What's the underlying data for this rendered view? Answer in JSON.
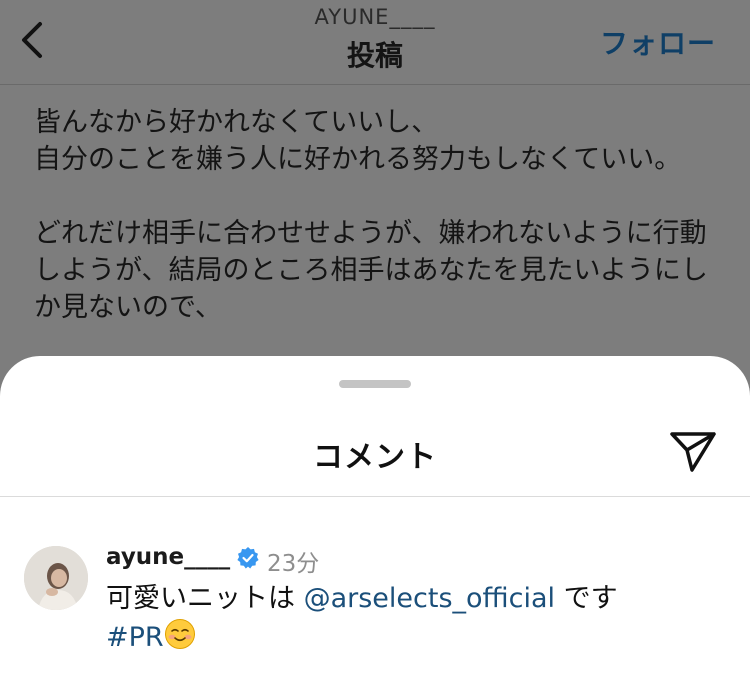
{
  "header": {
    "username": "AYUNE____",
    "title": "投稿",
    "follow_label": "フォロー"
  },
  "post": {
    "text": "皆んなから好かれなくていいし、\n自分のことを嫌う人に好かれる努力もしなくていい。\n\nどれだけ相手に合わせせようが、嫌われないように行動しようが、結局のところ相手はあなたを見たいようにしか見ないので、"
  },
  "sheet": {
    "title": "コメント"
  },
  "comment": {
    "username": "ayune____",
    "time": "23分",
    "text_before": "可愛いニットは ",
    "mention": "@arselects_official",
    "text_after": " です",
    "hashtag": "#PR",
    "emoji_name": "smiling-face-emoji"
  },
  "colors": {
    "overlay": "#7d7d7d",
    "link": "#1b4f7a",
    "verified": "#3897f0",
    "muted": "#8e8e8e"
  }
}
